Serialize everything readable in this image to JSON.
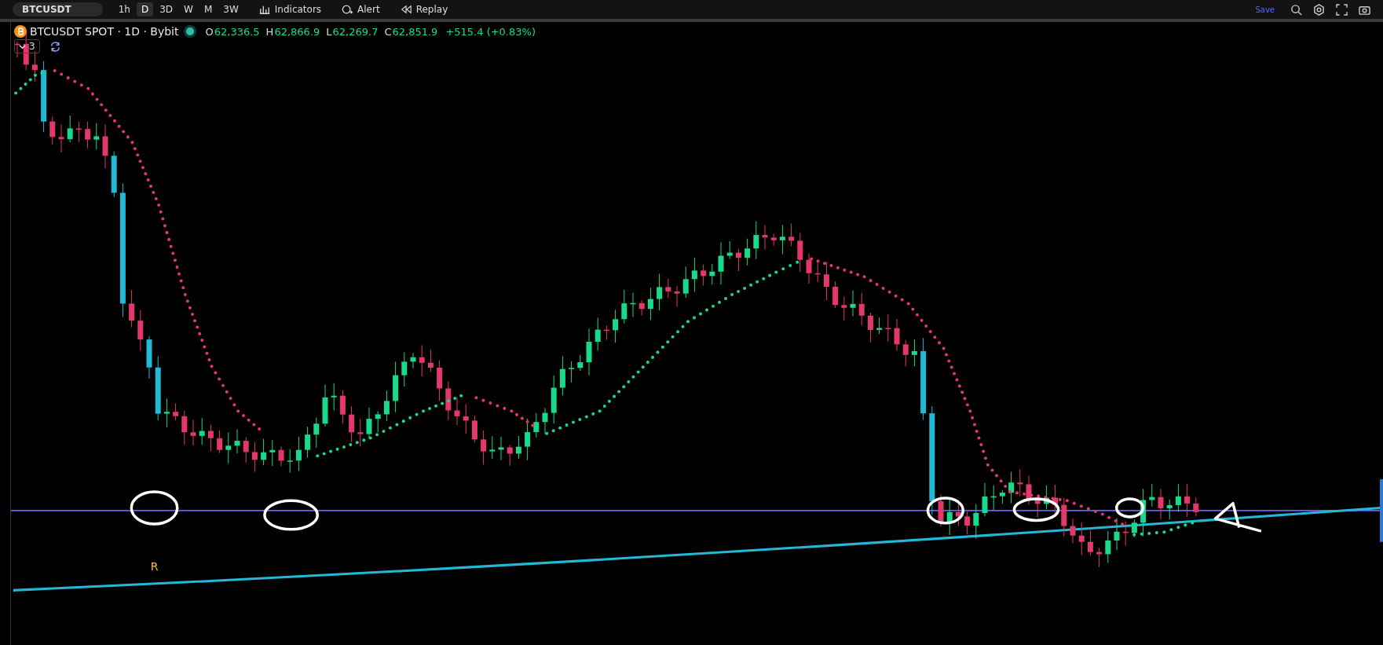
{
  "toolbar": {
    "symbol": "BTCUSDT",
    "timeframes": [
      {
        "label": "1h",
        "selected": false
      },
      {
        "label": "D",
        "selected": true
      },
      {
        "label": "3D",
        "selected": false
      },
      {
        "label": "W",
        "selected": false
      },
      {
        "label": "M",
        "selected": false
      },
      {
        "label": "3W",
        "selected": false
      }
    ],
    "buttons": [
      {
        "kind": "indicators",
        "label": "Indicators"
      },
      {
        "kind": "alert",
        "label": "Alert"
      },
      {
        "kind": "replay",
        "label": "Replay"
      }
    ],
    "save": "Save"
  },
  "legend": {
    "title": "BTCUSDT SPOT · 1D · Bybit",
    "ohlc": [
      {
        "label": "O",
        "value": "62,336.5"
      },
      {
        "label": "H",
        "value": "62,866.9"
      },
      {
        "label": "L",
        "value": "62,269.7"
      },
      {
        "label": "C",
        "value": "62,851.9"
      }
    ],
    "change": "+515.4 (+0.83%)",
    "indicator_count": "3"
  },
  "chart": {
    "marker_label": "R"
  }
}
